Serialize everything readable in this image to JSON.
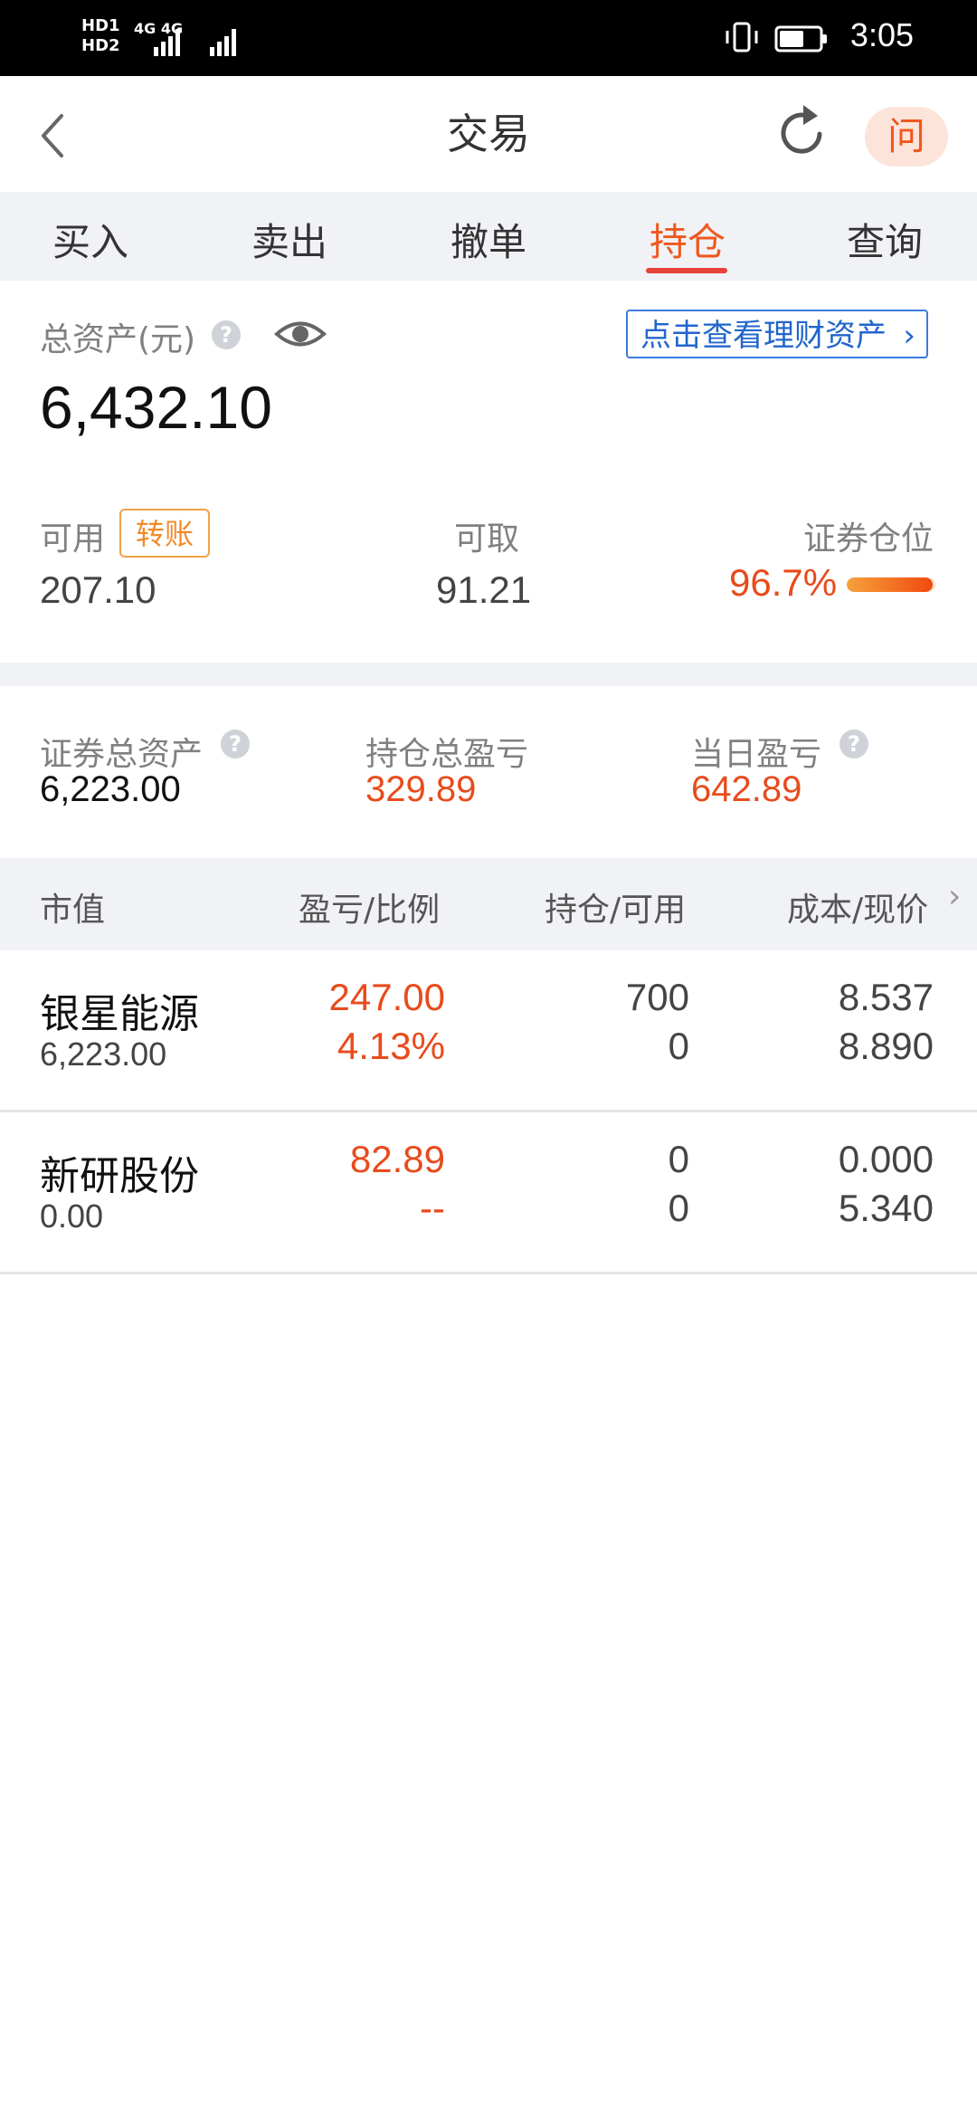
{
  "status_bar": {
    "time": "3:05",
    "sim_labels": "HD1 HD2",
    "network": "4G 4G",
    "icons": [
      "vibrate-icon",
      "battery-icon"
    ]
  },
  "header": {
    "title": "交易",
    "ask_label": "问",
    "icons": [
      "back-icon",
      "refresh-icon"
    ]
  },
  "tabs": [
    {
      "label": "买入"
    },
    {
      "label": "卖出"
    },
    {
      "label": "撤单"
    },
    {
      "label": "持仓",
      "active": true
    },
    {
      "label": "查询"
    }
  ],
  "assets": {
    "total_label": "总资产(元)",
    "total_value": "6,432.10",
    "wealth_link": "点击查看理财资产",
    "available_label": "可用",
    "transfer_label": "转账",
    "available_value": "207.10",
    "withdrawable_label": "可取",
    "withdrawable_value": "91.21",
    "position_label": "证券仓位",
    "position_value": "96.7%",
    "position_ratio": 0.967
  },
  "summary": {
    "securities_label": "证券总资产",
    "securities_value": "6,223.00",
    "holding_pl_label": "持仓总盈亏",
    "holding_pl_value": "329.89",
    "daily_pl_label": "当日盈亏",
    "daily_pl_value": "642.89"
  },
  "table": {
    "headers": [
      "市值",
      "盈亏/比例",
      "持仓/可用",
      "成本/现价"
    ],
    "rows": [
      {
        "name": "银星能源",
        "market_value": "6,223.00",
        "pl": "247.00",
        "pl_ratio": "4.13%",
        "holding": "700",
        "available": "0",
        "cost": "8.537",
        "price": "8.890"
      },
      {
        "name": "新研股份",
        "market_value": "0.00",
        "pl": "82.89",
        "pl_ratio": "--",
        "holding": "0",
        "available": "0",
        "cost": "0.000",
        "price": "5.340"
      }
    ]
  },
  "colors": {
    "accent": "#f0581e",
    "profit": "#e84b1c",
    "link": "#2266cc",
    "tab_underline": "#e8433a"
  }
}
